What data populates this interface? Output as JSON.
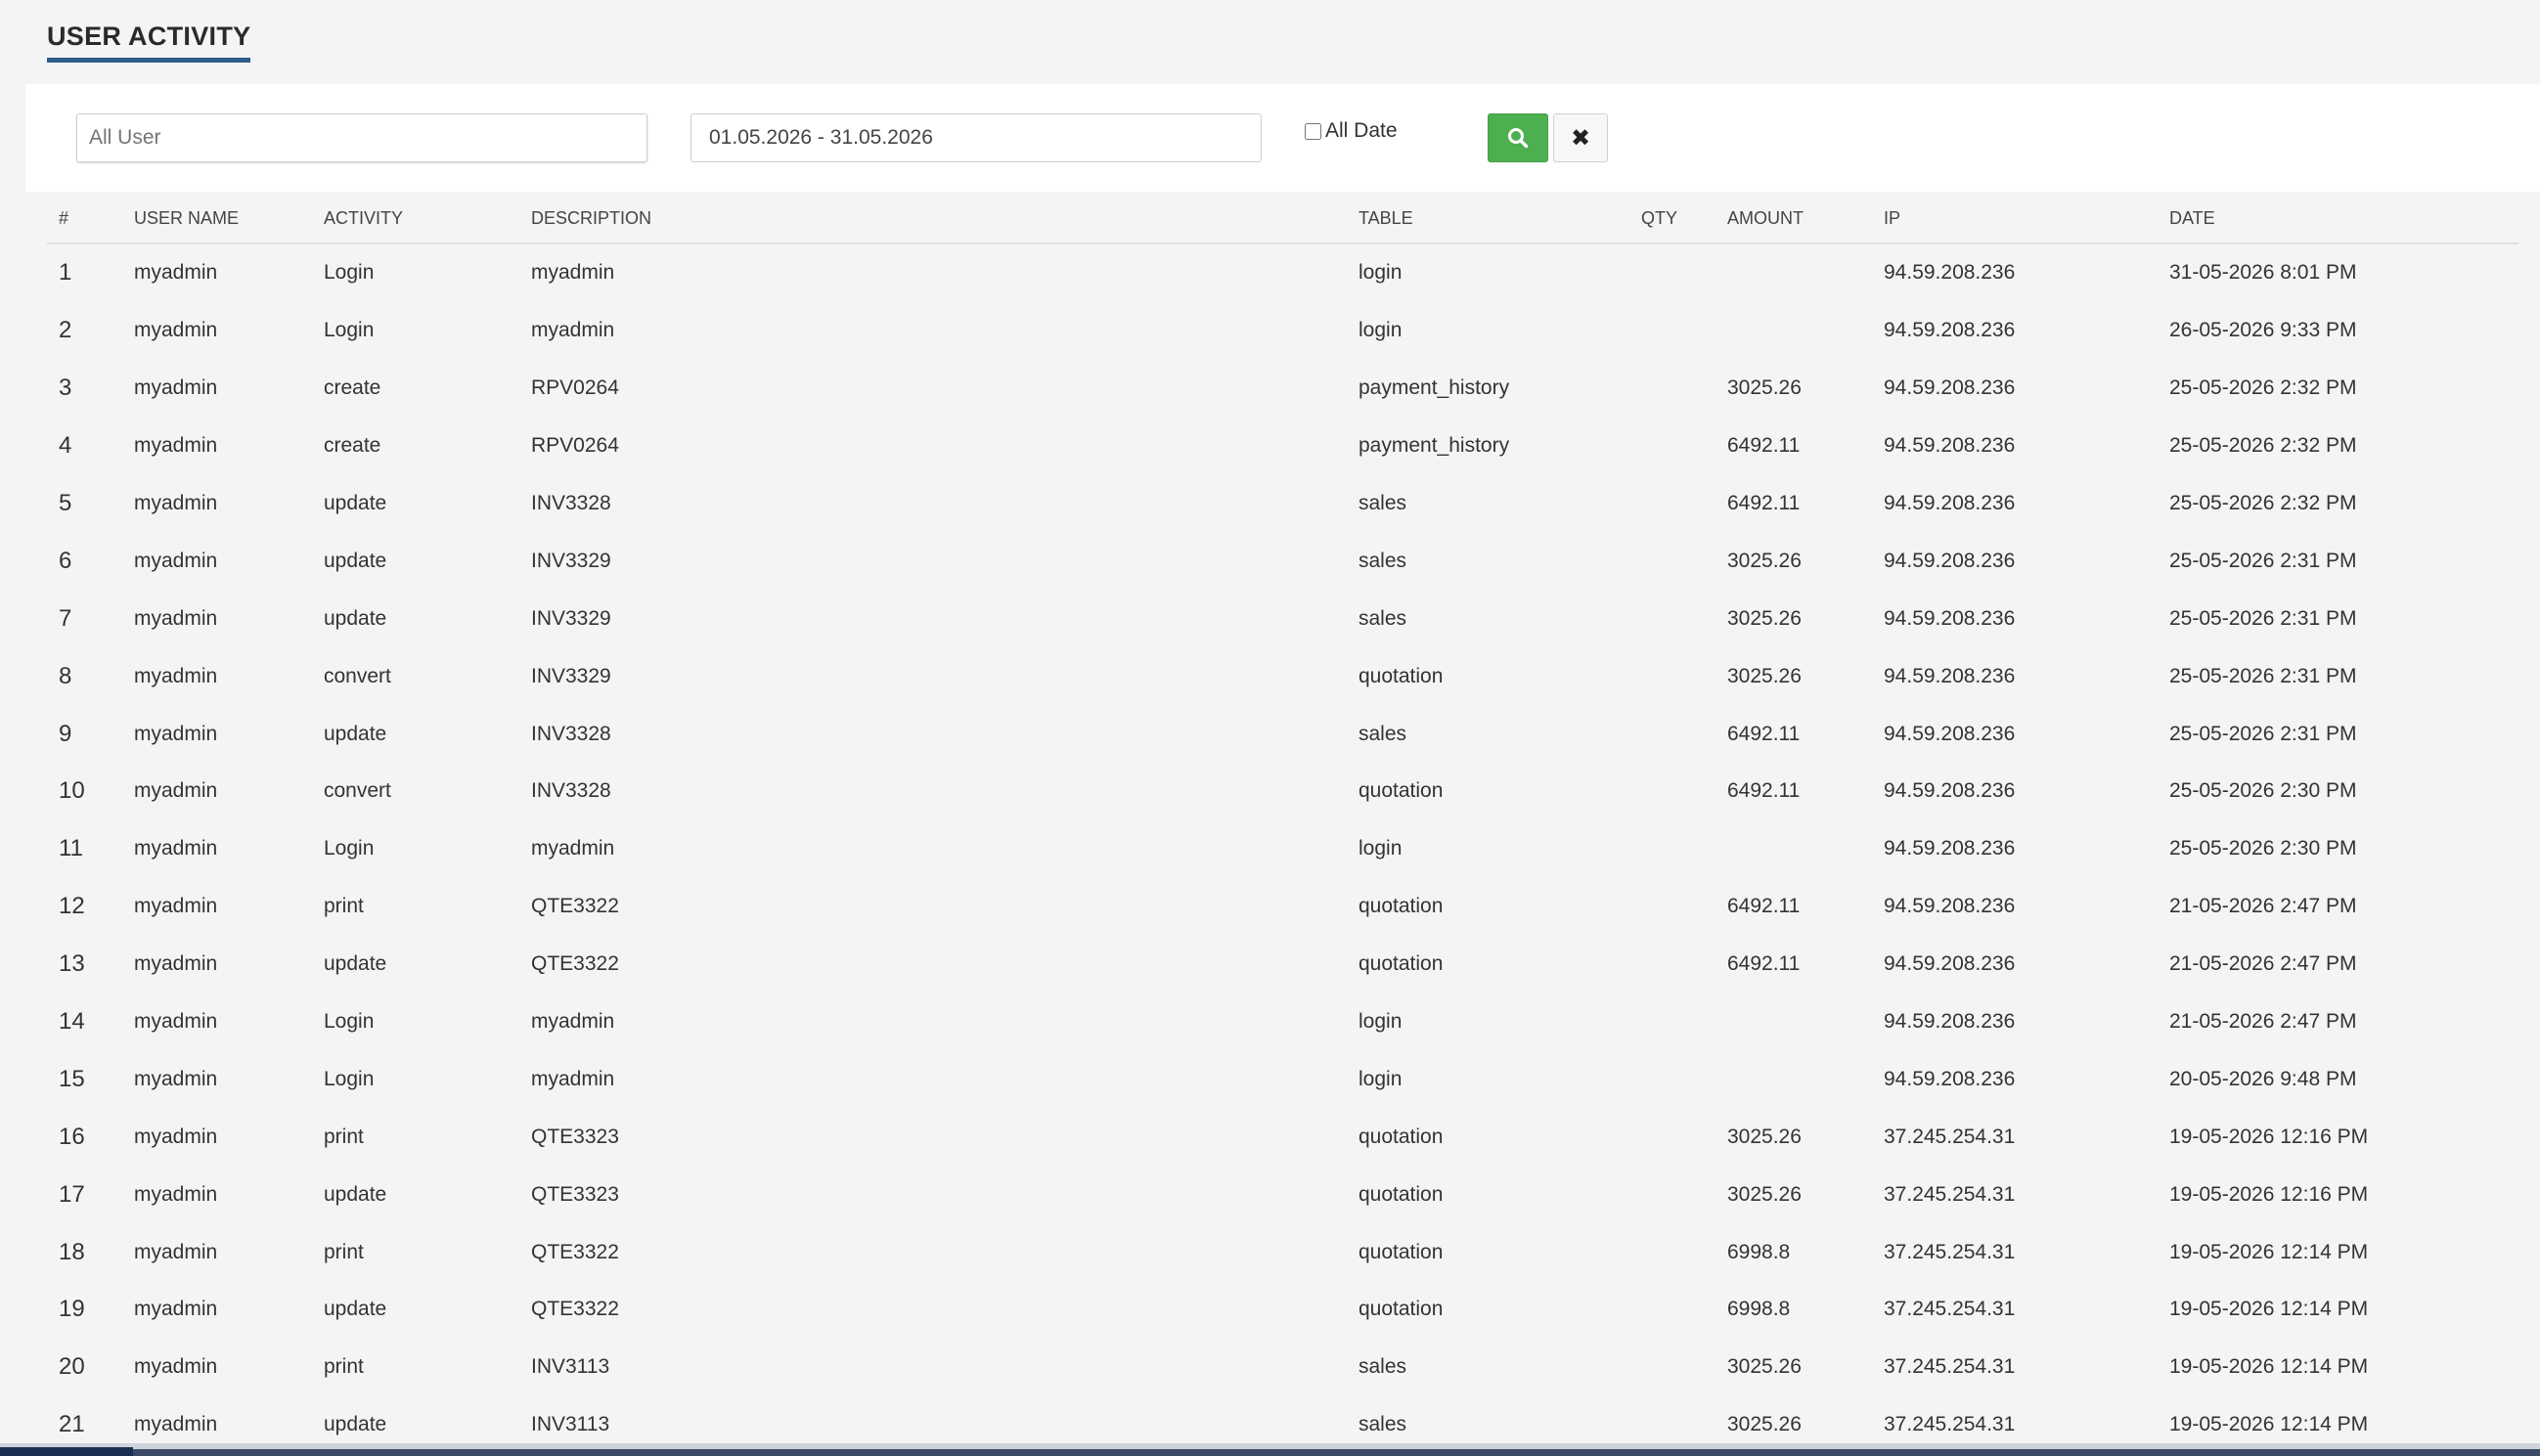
{
  "page": {
    "title": "USER ACTIVITY"
  },
  "filters": {
    "user_placeholder": "All User",
    "date_range": "01.05.2026 - 31.05.2026",
    "all_date_label": "All Date",
    "all_date_checked": false
  },
  "icons": {
    "search": "search-icon",
    "clear": "close-icon"
  },
  "colors": {
    "accent": "#2c5c8a",
    "search_button": "#4caf50"
  },
  "table": {
    "headers": [
      "#",
      "USER NAME",
      "ACTIVITY",
      "DESCRIPTION",
      "TABLE",
      "QTY",
      "AMOUNT",
      "IP",
      "DATE"
    ],
    "rows": [
      [
        "1",
        "myadmin",
        "Login",
        "myadmin",
        "login",
        "",
        "",
        "94.59.208.236",
        "31-05-2026 8:01 PM"
      ],
      [
        "2",
        "myadmin",
        "Login",
        "myadmin",
        "login",
        "",
        "",
        "94.59.208.236",
        "26-05-2026 9:33 PM"
      ],
      [
        "3",
        "myadmin",
        "create",
        "RPV0264",
        "payment_history",
        "",
        "3025.26",
        "94.59.208.236",
        "25-05-2026 2:32 PM"
      ],
      [
        "4",
        "myadmin",
        "create",
        "RPV0264",
        "payment_history",
        "",
        "6492.11",
        "94.59.208.236",
        "25-05-2026 2:32 PM"
      ],
      [
        "5",
        "myadmin",
        "update",
        "INV3328",
        "sales",
        "",
        "6492.11",
        "94.59.208.236",
        "25-05-2026 2:32 PM"
      ],
      [
        "6",
        "myadmin",
        "update",
        "INV3329",
        "sales",
        "",
        "3025.26",
        "94.59.208.236",
        "25-05-2026 2:31 PM"
      ],
      [
        "7",
        "myadmin",
        "update",
        "INV3329",
        "sales",
        "",
        "3025.26",
        "94.59.208.236",
        "25-05-2026 2:31 PM"
      ],
      [
        "8",
        "myadmin",
        "convert",
        "INV3329",
        "quotation",
        "",
        "3025.26",
        "94.59.208.236",
        "25-05-2026 2:31 PM"
      ],
      [
        "9",
        "myadmin",
        "update",
        "INV3328",
        "sales",
        "",
        "6492.11",
        "94.59.208.236",
        "25-05-2026 2:31 PM"
      ],
      [
        "10",
        "myadmin",
        "convert",
        "INV3328",
        "quotation",
        "",
        "6492.11",
        "94.59.208.236",
        "25-05-2026 2:30 PM"
      ],
      [
        "11",
        "myadmin",
        "Login",
        "myadmin",
        "login",
        "",
        "",
        "94.59.208.236",
        "25-05-2026 2:30 PM"
      ],
      [
        "12",
        "myadmin",
        "print",
        "QTE3322",
        "quotation",
        "",
        "6492.11",
        "94.59.208.236",
        "21-05-2026 2:47 PM"
      ],
      [
        "13",
        "myadmin",
        "update",
        "QTE3322",
        "quotation",
        "",
        "6492.11",
        "94.59.208.236",
        "21-05-2026 2:47 PM"
      ],
      [
        "14",
        "myadmin",
        "Login",
        "myadmin",
        "login",
        "",
        "",
        "94.59.208.236",
        "21-05-2026 2:47 PM"
      ],
      [
        "15",
        "myadmin",
        "Login",
        "myadmin",
        "login",
        "",
        "",
        "94.59.208.236",
        "20-05-2026 9:48 PM"
      ],
      [
        "16",
        "myadmin",
        "print",
        "QTE3323",
        "quotation",
        "",
        "3025.26",
        "37.245.254.31",
        "19-05-2026 12:16 PM"
      ],
      [
        "17",
        "myadmin",
        "update",
        "QTE3323",
        "quotation",
        "",
        "3025.26",
        "37.245.254.31",
        "19-05-2026 12:16 PM"
      ],
      [
        "18",
        "myadmin",
        "print",
        "QTE3322",
        "quotation",
        "",
        "6998.8",
        "37.245.254.31",
        "19-05-2026 12:14 PM"
      ],
      [
        "19",
        "myadmin",
        "update",
        "QTE3322",
        "quotation",
        "",
        "6998.8",
        "37.245.254.31",
        "19-05-2026 12:14 PM"
      ],
      [
        "20",
        "myadmin",
        "print",
        "INV3113",
        "sales",
        "",
        "3025.26",
        "37.245.254.31",
        "19-05-2026 12:14 PM"
      ],
      [
        "21",
        "myadmin",
        "update",
        "INV3113",
        "sales",
        "",
        "3025.26",
        "37.245.254.31",
        "19-05-2026 12:14 PM"
      ]
    ]
  }
}
